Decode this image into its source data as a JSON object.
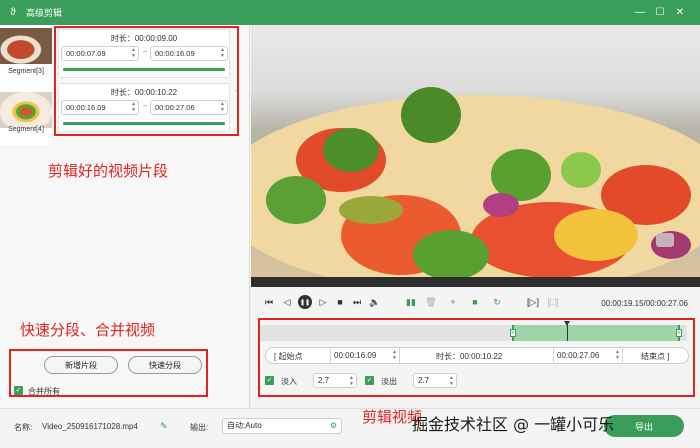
{
  "window": {
    "title": "高级剪辑",
    "minimize_icon": "minimize-icon",
    "maximize_icon": "maximize-icon",
    "close_icon": "close-icon"
  },
  "segments_panel": {
    "thumbnails": [
      {
        "label": "Segment[3]"
      },
      {
        "label": "Segment[4]"
      }
    ],
    "cards": [
      {
        "duration": "时长：00:00:09.00",
        "start": "00:00:07.09",
        "end": "00:00:16.09",
        "progress": 1.0
      },
      {
        "duration": "时长：00:00:10.22",
        "start": "00:00:16.09",
        "end": "00:00:27.06",
        "progress": 1.0
      }
    ],
    "collapse_glyph": "‹"
  },
  "annotations": {
    "clipped_segments": "剪辑好的视频片段",
    "quick_split_merge": "快速分段、合并视频",
    "edit_video": "剪辑视频"
  },
  "left_actions": {
    "add_segment": "新增片段",
    "quick_split": "快速分段",
    "merge_all_label": "合并所有",
    "merge_all_checked": true
  },
  "player": {
    "current_time": "00:00:19.15/00:00:27.06",
    "buttons": [
      "prev-frame",
      "step-back",
      "pause",
      "step-forward",
      "stop",
      "next-frame",
      "volume",
      "split",
      "delete",
      "add",
      "copy",
      "reset",
      "mark-in",
      "mark-out"
    ]
  },
  "trim": {
    "start_button": "[  起始点",
    "start_time": "00:00:16.09",
    "duration": "时长：00:00:10.22",
    "end_time": "00:00:27.06",
    "end_button": "结束点  ]",
    "fade_in_label": "淡入",
    "fade_in_value": "2.7",
    "fade_in_checked": true,
    "fade_out_label": "淡出",
    "fade_out_value": "2.7",
    "fade_out_checked": true
  },
  "footer": {
    "name_label": "名称:",
    "file_name": "Video_250916171028.mp4",
    "output_label": "输出:",
    "output_value": "自动;Auto",
    "export_button": "导出"
  },
  "watermark": "掘金技术社区 @ 一罐小可乐",
  "colors": {
    "accent": "#3a9e5a",
    "annotation_red": "#e02424"
  }
}
